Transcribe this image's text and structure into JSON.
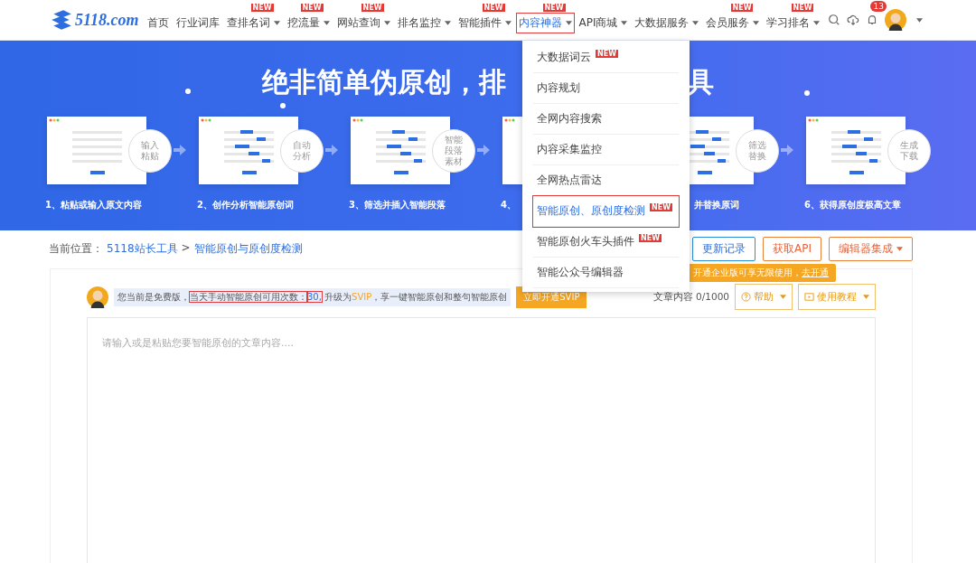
{
  "header": {
    "logo": "5118.com",
    "nav": [
      {
        "label": "首页",
        "caret": false,
        "selected": false,
        "highlighted": false
      },
      {
        "label": "行业词库",
        "caret": false,
        "selected": false,
        "highlighted": false
      },
      {
        "label": "查排名词",
        "caret": true,
        "badge": "NEW",
        "selected": false,
        "highlighted": false
      },
      {
        "label": "挖流量",
        "caret": true,
        "badge": "NEW",
        "selected": false,
        "highlighted": false
      },
      {
        "label": "网站查询",
        "caret": true,
        "badge": "NEW",
        "selected": false,
        "highlighted": false
      },
      {
        "label": "排名监控",
        "caret": true,
        "selected": false,
        "highlighted": false
      },
      {
        "label": "智能插件",
        "caret": true,
        "badge": "NEW",
        "selected": false,
        "highlighted": false
      },
      {
        "label": "内容神器",
        "caret": true,
        "badge": "NEW",
        "selected": true,
        "highlighted": true
      },
      {
        "label": "API商城",
        "caret": true,
        "selected": false,
        "highlighted": false
      },
      {
        "label": "大数据服务",
        "caret": true,
        "selected": false,
        "highlighted": false
      },
      {
        "label": "会员服务",
        "caret": true,
        "badge": "NEW",
        "selected": false,
        "highlighted": false
      },
      {
        "label": "学习排名",
        "caret": true,
        "badge": "NEW",
        "selected": false,
        "highlighted": false
      }
    ],
    "notification_count": "13"
  },
  "banner": {
    "title_left": "绝非简单伪原创，排",
    "title_right": "具",
    "steps": [
      {
        "label": "1、粘贴或输入原文内容",
        "badge": "输入粘贴",
        "label_cut": false,
        "arrow": true
      },
      {
        "label": "2、创作分析智能原创词",
        "badge": "自动分析",
        "label_cut": false,
        "arrow": true
      },
      {
        "label": "3、筛选并插入智能段落",
        "badge": "智能段落素材",
        "label_cut": false,
        "arrow": true
      },
      {
        "label": "4、",
        "label_cut": false,
        "arrow": false
      },
      {
        "label": "并替换原词",
        "badge": "筛选替换",
        "label_cut": true,
        "arrow": true
      },
      {
        "label": "6、获得原创度极高文章",
        "badge": "生成下载",
        "label_cut": false,
        "arrow": false
      }
    ]
  },
  "dropdown": {
    "items": [
      {
        "label": "大数据词云",
        "badge": "NEW",
        "selected": false
      },
      {
        "label": "内容规划",
        "selected": false
      },
      {
        "label": "全网内容搜索",
        "selected": false
      },
      {
        "label": "内容采集监控",
        "selected": false
      },
      {
        "label": "全网热点雷达",
        "selected": false
      },
      {
        "label": "智能原创、原创度检测",
        "badge": "NEW",
        "selected": true
      },
      {
        "label": "智能原创火车头插件",
        "badge": "NEW",
        "selected": false
      },
      {
        "label": "智能公众号编辑器",
        "selected": false
      }
    ]
  },
  "breadcrumb": {
    "prefix": "当前位置：",
    "items": [
      "5118站长工具",
      "智能原创与原创度检测"
    ],
    "separator": ">"
  },
  "actions": [
    {
      "label": "更新记录",
      "kind": "blue",
      "caret": false
    },
    {
      "label": "获取API",
      "kind": "orange",
      "caret": false
    },
    {
      "label": "编辑器集成",
      "kind": "orange",
      "caret": true
    }
  ],
  "tooltip": {
    "text": "开通企业版可享无限使用，",
    "link": "去开通"
  },
  "notice": {
    "parts": [
      {
        "text": "您当前是免费版，",
        "kind": "plain",
        "highlighted": false
      },
      {
        "text": "当天手动智能原创可用次数：",
        "kind": "plain",
        "highlighted": true
      },
      {
        "text": "30,",
        "kind": "number",
        "highlighted": true
      },
      {
        "text": " 升级为",
        "kind": "plain",
        "highlighted": false
      },
      {
        "text": "SVIP",
        "kind": "accent",
        "highlighted": false
      },
      {
        "text": "，享一键智能原创和整句智能原创",
        "kind": "plain",
        "highlighted": false
      }
    ],
    "button": "立即开通SVIP"
  },
  "counter": "文章内容 0/1000",
  "tools": [
    {
      "label": "帮助"
    },
    {
      "label": "使用教程"
    }
  ],
  "editor": {
    "placeholder": "请输入或是粘贴您要智能原创的文章内容...."
  }
}
